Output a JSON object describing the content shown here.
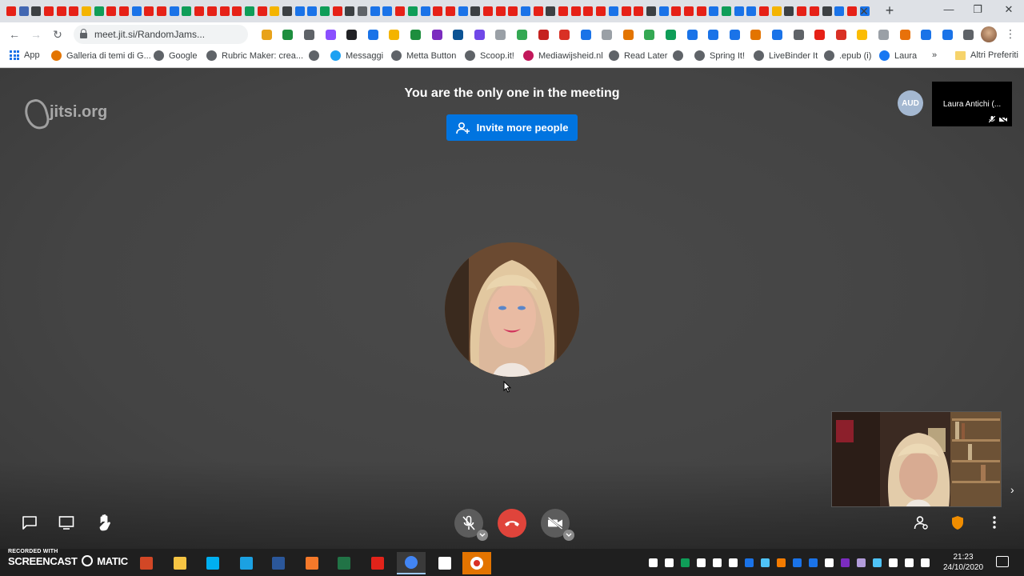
{
  "browser": {
    "url": "meet.jit.si/RandomJams...",
    "tab_favicon_colors": [
      "#e62117",
      "#4267b2",
      "#3c4043",
      "#e62117",
      "#e62117",
      "#e62117",
      "#f4b400",
      "#0f9d58",
      "#e62117",
      "#e62117",
      "#1a73e8",
      "#e62117",
      "#e62117",
      "#1a73e8",
      "#0f9d58",
      "#e62117",
      "#e62117",
      "#e62117",
      "#e62117",
      "#0f9d58",
      "#e62117",
      "#f4b400",
      "#3c4043",
      "#1a73e8",
      "#1a73e8",
      "#0f9d58",
      "#e62117",
      "#3c4043",
      "#5f6368",
      "#1a73e8",
      "#1a73e8",
      "#e62117",
      "#0f9d58",
      "#1a73e8",
      "#e62117",
      "#e62117",
      "#1a73e8",
      "#3c4043",
      "#e62117",
      "#e62117",
      "#e62117",
      "#1a73e8",
      "#e62117",
      "#3c4043",
      "#e62117",
      "#e62117",
      "#e62117",
      "#e62117",
      "#1a73e8",
      "#e62117",
      "#e62117",
      "#3c4043",
      "#1a73e8",
      "#e62117",
      "#e62117",
      "#e62117",
      "#1a73e8",
      "#0f9d58",
      "#1a73e8",
      "#1a73e8",
      "#e62117",
      "#f4b400",
      "#3c4043",
      "#e62117",
      "#e62117",
      "#3c4043",
      "#1a73e8",
      "#e62117",
      "#1a73e8"
    ],
    "extension_colors": [
      "#e8a21a",
      "#1e8e3e",
      "#5f6368",
      "#8a4fff",
      "#202124",
      "#1a73e8",
      "#f4b400",
      "#1e8e3e",
      "#7b2cbf",
      "#0b5394",
      "#7048e8",
      "#9aa0a6",
      "#34a853",
      "#c5221f",
      "#d93025",
      "#1a73e8",
      "#9aa0a6",
      "#e37400",
      "#34a853",
      "#0f9d58",
      "#1a73e8",
      "#1a73e8",
      "#1a73e8",
      "#e37400",
      "#1a73e8",
      "#5f6368",
      "#e62117",
      "#d93025",
      "#fbbc04",
      "#9aa0a6",
      "#e8710a",
      "#1a73e8",
      "#1a73e8",
      "#5f6368"
    ],
    "bookmarks": [
      {
        "label": "App",
        "icon": "apps-grid-icon"
      },
      {
        "label": "Galleria di temi di G...",
        "icon": "theme-gallery-icon",
        "color": "#e37400"
      },
      {
        "label": "Google",
        "icon": "globe-icon",
        "color": "#5f6368"
      },
      {
        "label": "Rubric Maker: crea...",
        "icon": "rubric-icon",
        "color": "#5f6368"
      },
      {
        "label": "",
        "icon": "globe-icon",
        "color": "#5f6368"
      },
      {
        "label": "Messaggi",
        "icon": "twitter-icon",
        "color": "#1da1f2"
      },
      {
        "label": "Metta Button",
        "icon": "globe-icon",
        "color": "#5f6368"
      },
      {
        "label": "Scoop.it!",
        "icon": "globe-icon",
        "color": "#5f6368"
      },
      {
        "label": "Mediawijsheid.nl",
        "icon": "mediawijsheid-icon",
        "color": "#c2185b"
      },
      {
        "label": "Read Later",
        "icon": "globe-icon",
        "color": "#5f6368"
      },
      {
        "label": "",
        "icon": "globe-icon",
        "color": "#5f6368"
      },
      {
        "label": "Spring It!",
        "icon": "globe-icon",
        "color": "#5f6368"
      },
      {
        "label": "LiveBinder It",
        "icon": "globe-icon",
        "color": "#5f6368"
      },
      {
        "label": ".epub (i)",
        "icon": "globe-icon",
        "color": "#5f6368"
      },
      {
        "label": "Laura",
        "icon": "facebook-icon",
        "color": "#1877f2"
      }
    ],
    "bookmarks_more": "»",
    "other_bookmarks": "Altri Preferiti"
  },
  "meeting": {
    "logo_text": "jitsi.org",
    "title": "You are the only one in the meeting",
    "invite_button": "Invite more people",
    "aud_badge": "AUD",
    "remote_participant": "Laura Antichi (..."
  },
  "taskbar": {
    "watermark_top": "RECORDED WITH",
    "watermark_bottom": "SCREENCAST",
    "watermark_suffix": "MATIC",
    "time": "21:23",
    "date": "24/10/2020",
    "apps": [
      {
        "name": "powerpoint-icon",
        "color": "#d24726"
      },
      {
        "name": "file-explorer-icon",
        "color": "#f6c443"
      },
      {
        "name": "skype-icon",
        "color": "#00aff0"
      },
      {
        "name": "internet-explorer-icon",
        "color": "#1ba1e2"
      },
      {
        "name": "word-icon",
        "color": "#2b579a"
      },
      {
        "name": "blender-icon",
        "color": "#f5792a"
      },
      {
        "name": "excel-icon",
        "color": "#217346"
      },
      {
        "name": "acrobat-icon",
        "color": "#e2231a"
      },
      {
        "name": "chrome-icon",
        "color": "#4285f4"
      },
      {
        "name": "notepad-icon",
        "color": "#ffffff"
      },
      {
        "name": "screencast-o-matic-icon",
        "color": "#ffffff"
      }
    ],
    "tray_colors": [
      "#ffffff",
      "#ffffff",
      "#0f9d58",
      "#ffffff",
      "#ffffff",
      "#ffffff",
      "#1a73e8",
      "#4fc3f7",
      "#f57c00",
      "#1a73e8",
      "#1a73e8",
      "#ffffff",
      "#7b2cbf",
      "#b39ddb",
      "#4fc3f7",
      "#ffffff",
      "#ffffff",
      "#ffffff"
    ]
  }
}
